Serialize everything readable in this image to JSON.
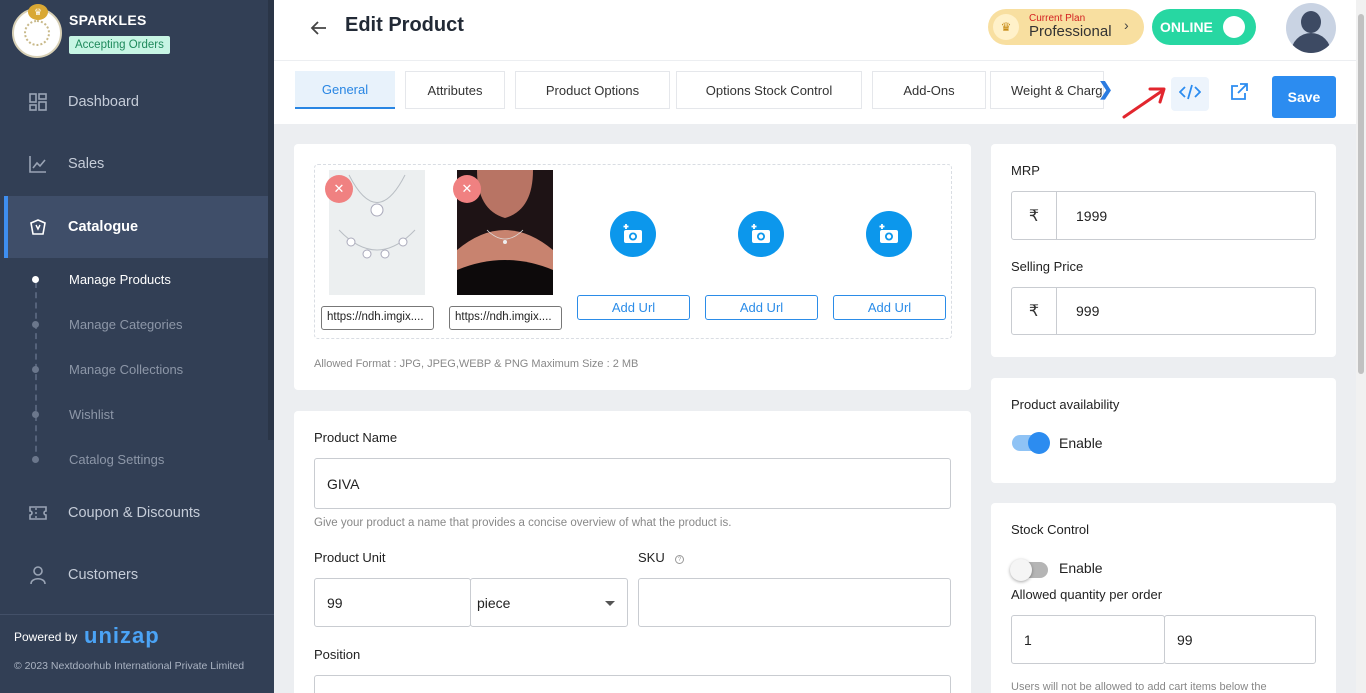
{
  "store": {
    "name": "SPARKLES",
    "status": "Accepting Orders"
  },
  "nav": {
    "items": [
      {
        "label": "Dashboard",
        "icon": "dashboard-icon"
      },
      {
        "label": "Sales",
        "icon": "chart-line-icon"
      },
      {
        "label": "Catalogue",
        "icon": "catalogue-icon",
        "active": true
      },
      {
        "label": "Coupon & Discounts",
        "icon": "coupon-icon"
      },
      {
        "label": "Customers",
        "icon": "user-icon"
      }
    ],
    "sub_items": [
      "Manage Products",
      "Manage Categories",
      "Manage Collections",
      "Wishlist",
      "Catalog Settings"
    ]
  },
  "footer": {
    "powered_by": "Powered by",
    "brand": "unizap",
    "copyright": "© 2023 Nextdoorhub International Private Limited"
  },
  "header": {
    "title": "Edit Product",
    "plan_label": "Current Plan",
    "plan_name": "Professional",
    "online_label": "ONLINE"
  },
  "tabs": [
    "General",
    "Attributes",
    "Product Options",
    "Options Stock Control",
    "Add-Ons",
    "Weight & Charg"
  ],
  "toolbar": {
    "save_label": "Save"
  },
  "images": {
    "urls": [
      "https://ndh.imgix....",
      "https://ndh.imgix...."
    ],
    "add_url_label": "Add Url",
    "hint": "Allowed Format : JPG, JPEG,WEBP & PNG Maximum Size : 2 MB"
  },
  "product": {
    "name_label": "Product Name",
    "name_value": "GIVA",
    "name_hint": "Give your product a name that provides a concise overview of what the product is.",
    "unit_label": "Product Unit",
    "unit_value": "99",
    "unit_type": "piece",
    "sku_label": "SKU",
    "sku_value": "",
    "position_label": "Position"
  },
  "pricing": {
    "mrp_label": "MRP",
    "mrp_value": "1999",
    "selling_label": "Selling Price",
    "selling_value": "999",
    "currency": "₹"
  },
  "availability": {
    "label": "Product availability",
    "toggle_label": "Enable",
    "enabled": true
  },
  "stock": {
    "label": "Stock Control",
    "toggle_label": "Enable",
    "enabled": false,
    "allowed_label": "Allowed quantity per order",
    "min_value": "1",
    "max_value": "99",
    "note": "Users will not be allowed to add cart items below the"
  },
  "colors": {
    "accent": "#2c8cf0",
    "sidebar": "#323f55",
    "online": "#27d7a2",
    "remove": "#f08181"
  }
}
